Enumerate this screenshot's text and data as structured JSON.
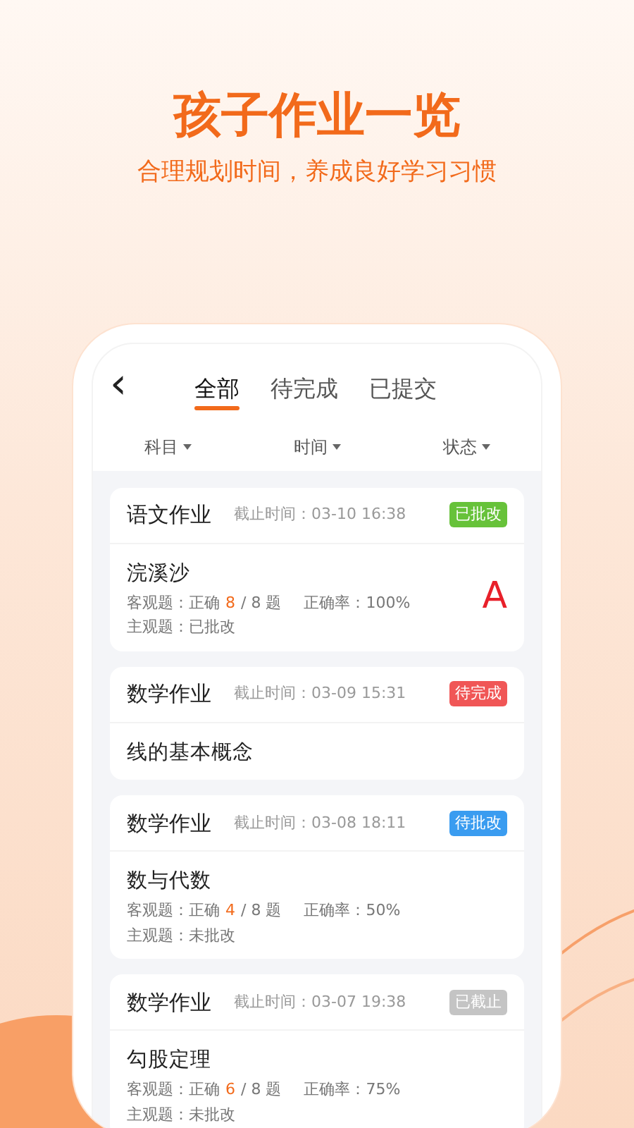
{
  "headline": {
    "title": "孩子作业一览",
    "subtitle": "合理规划时间，养成良好学习习惯"
  },
  "nav": {
    "back": "‹"
  },
  "tabs": [
    {
      "label": "全部",
      "selected": true
    },
    {
      "label": "待完成",
      "selected": false
    },
    {
      "label": "已提交",
      "selected": false
    }
  ],
  "filters": [
    {
      "label": "科目"
    },
    {
      "label": "时间"
    },
    {
      "label": "状态"
    }
  ],
  "cards": [
    {
      "subject": "语文作业",
      "deadline": "截止时间：03-10 16:38",
      "status": "已批改",
      "color": "#67c23a",
      "name": "浣溪沙",
      "objective_label": "客观题：正确",
      "correct": "8",
      "total": "/ 8 题",
      "rate": "正确率：100%",
      "subjective": "主观题：已批改",
      "grade": "A"
    },
    {
      "subject": "数学作业",
      "deadline": "截止时间：03-09 15:31",
      "status": "待完成",
      "color": "#f05656",
      "name": "线的基本概念"
    },
    {
      "subject": "数学作业",
      "deadline": "截止时间：03-08 18:11",
      "status": "待批改",
      "color": "#3a9cf0",
      "name": "数与代数",
      "objective_label": "客观题：正确",
      "correct": "4",
      "total": "/ 8 题",
      "rate": "正确率：50%",
      "subjective": "主观题：未批改"
    },
    {
      "subject": "数学作业",
      "deadline": "截止时间：03-07 19:38",
      "status": "已截止",
      "color": "#c4c4c4",
      "name": "勾股定理",
      "objective_label": "客观题：正确",
      "correct": "6",
      "total": "/ 8 题",
      "rate": "正确率：75%",
      "subjective": "主观题：未批改"
    }
  ]
}
